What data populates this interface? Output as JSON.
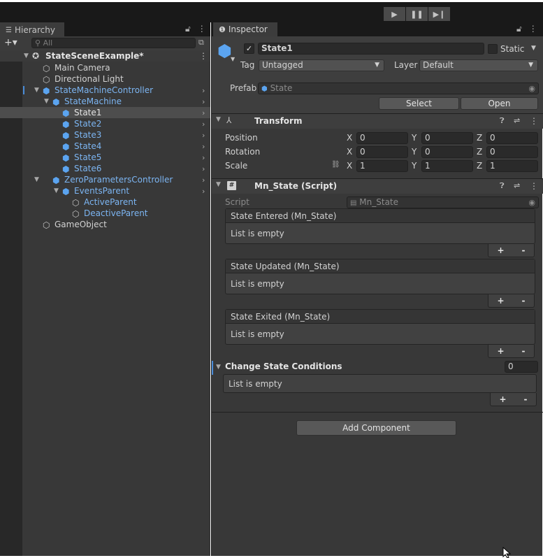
{
  "toolbar": {
    "play_icon": "play-icon",
    "pause_icon": "pause-icon",
    "step_icon": "step-icon"
  },
  "hierarchy": {
    "tab_label": "Hierarchy",
    "search_placeholder": "All",
    "scene_name": "StateSceneExample*",
    "items": [
      {
        "label": "Main Camera"
      },
      {
        "label": "Directional Light"
      },
      {
        "label": "StateMachineController"
      },
      {
        "label": "StateMachine"
      },
      {
        "label": "State1"
      },
      {
        "label": "State2"
      },
      {
        "label": "State3"
      },
      {
        "label": "State4"
      },
      {
        "label": "State5"
      },
      {
        "label": "State6"
      },
      {
        "label": "ZeroParametersController"
      },
      {
        "label": "EventsParent"
      },
      {
        "label": "ActiveParent"
      },
      {
        "label": "DeactiveParent"
      },
      {
        "label": "GameObject"
      }
    ]
  },
  "inspector": {
    "tab_label": "Inspector",
    "object_name": "State1",
    "static_label": "Static",
    "tag_label": "Tag",
    "tag_value": "Untagged",
    "layer_label": "Layer",
    "layer_value": "Default",
    "prefab_label": "Prefab",
    "prefab_value": "State",
    "select_button": "Select",
    "open_button": "Open",
    "transform": {
      "title": "Transform",
      "position_label": "Position",
      "rotation_label": "Rotation",
      "scale_label": "Scale",
      "x_label": "X",
      "y_label": "Y",
      "z_label": "Z",
      "position": [
        "0",
        "0",
        "0"
      ],
      "rotation": [
        "0",
        "0",
        "0"
      ],
      "scale": [
        "1",
        "1",
        "1"
      ]
    },
    "script_component": {
      "title": "Mn_State (Script)",
      "script_label": "Script",
      "script_value": "Mn_State",
      "events": [
        {
          "title": "State Entered (Mn_State)",
          "body": "List is empty"
        },
        {
          "title": "State Updated (Mn_State)",
          "body": "List is empty"
        },
        {
          "title": "State Exited (Mn_State)",
          "body": "List is empty"
        }
      ],
      "plus": "+",
      "minus": "-",
      "conditions_label": "Change State Conditions",
      "conditions_count": "0",
      "conditions_body": "List is empty"
    },
    "add_component": "Add Component"
  }
}
